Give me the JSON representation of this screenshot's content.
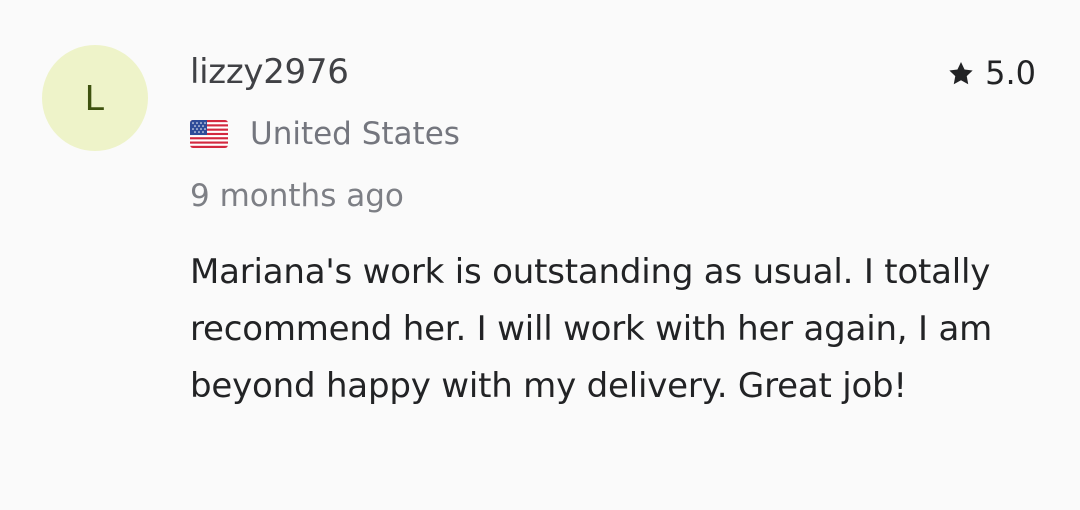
{
  "review": {
    "avatar_letter": "L",
    "username": "lizzy2976",
    "rating": "5.0",
    "country": "United States",
    "country_flag": "us-flag-icon",
    "time_ago": "9 months ago",
    "text": "Mariana's work is outstanding as usual. I totally recommend her. I will work with her again, I am beyond happy with my delivery. Great job!"
  },
  "colors": {
    "avatar_bg": "#eef3c9",
    "avatar_text": "#3e520f",
    "star": "#222325"
  }
}
